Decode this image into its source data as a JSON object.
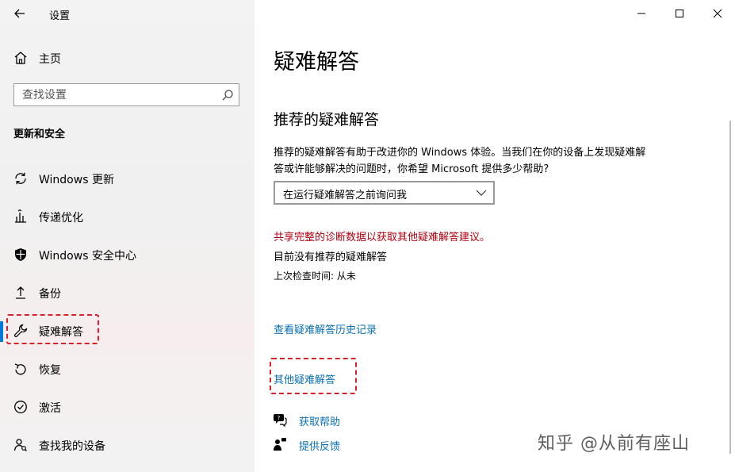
{
  "app": {
    "title": "设置"
  },
  "sidebar": {
    "home_label": "主页",
    "search_placeholder": "查找设置",
    "section_heading": "更新和安全",
    "items": [
      {
        "label": "Windows 更新",
        "icon": "refresh-icon"
      },
      {
        "label": "传递优化",
        "icon": "delivery-optimization-icon"
      },
      {
        "label": "Windows 安全中心",
        "icon": "shield-icon"
      },
      {
        "label": "备份",
        "icon": "backup-arrow-icon"
      },
      {
        "label": "疑难解答",
        "icon": "wrench-icon",
        "selected": true
      },
      {
        "label": "恢复",
        "icon": "recovery-icon"
      },
      {
        "label": "激活",
        "icon": "check-circle-icon"
      },
      {
        "label": "查找我的设备",
        "icon": "person-locate-icon"
      }
    ]
  },
  "main": {
    "page_title": "疑难解答",
    "recommended_heading": "推荐的疑难解答",
    "description": "推荐的疑难解答有助于改进你的 Windows 体验。当我们在你的设备上发现疑难解答或许能够解决的问题时，你希望 Microsoft 提供多少帮助?",
    "dropdown_value": "在运行疑难解答之前询问我",
    "warning_link": "共享完整的诊断数据以获取其他疑难解答建议。",
    "no_recommended": "目前没有推荐的疑难解答",
    "last_check": "上次检查时间: 从未",
    "history_link": "查看疑难解答历史记录",
    "other_link": "其他疑难解答",
    "get_help": "获取帮助",
    "give_feedback": "提供反馈"
  },
  "watermark": "知乎 @从前有座山",
  "colors": {
    "accent": "#0078d7",
    "link": "#0a6fb5",
    "warning": "#b2000f",
    "annotation": "#d9202a"
  }
}
